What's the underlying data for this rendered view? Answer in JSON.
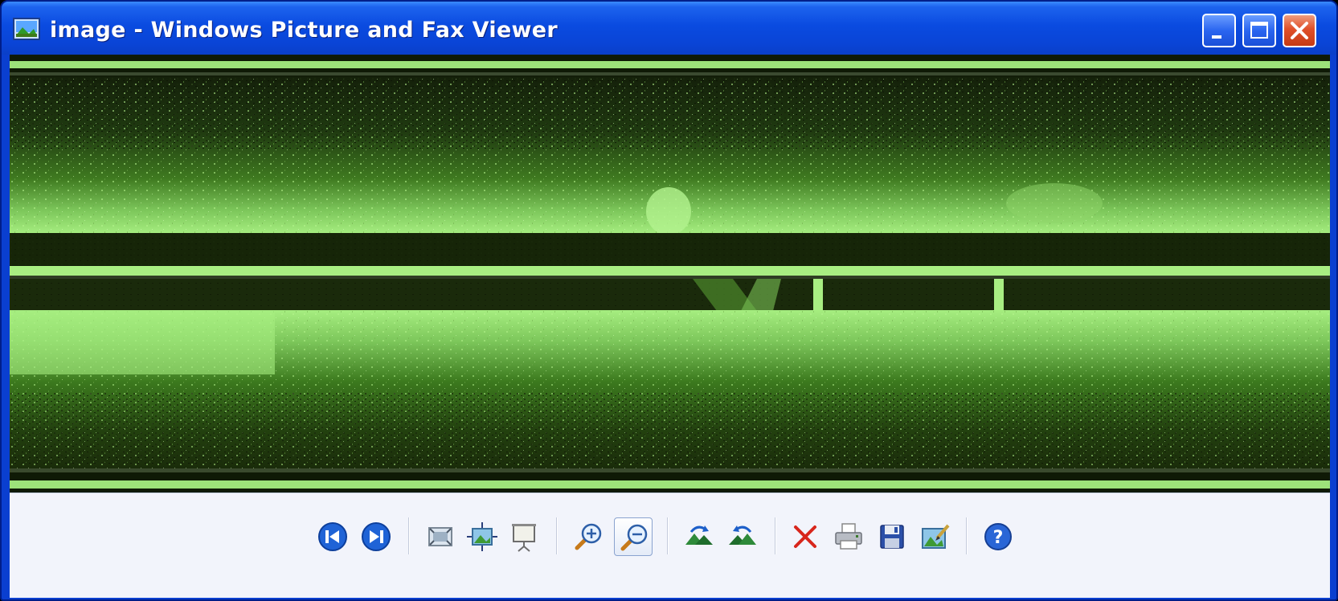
{
  "window": {
    "title": "image - Windows Picture and Fax Viewer",
    "icon": "picture-viewer-icon"
  },
  "caption_buttons": [
    "minimize-icon",
    "maximize-icon",
    "close-icon"
  ],
  "colors": {
    "titlebar": "#0a4be0",
    "close_button": "#e0502a",
    "image_bright_green": "#a6f27c",
    "image_dark": "#0f1a06",
    "toolbar_background": "#f2f4fb"
  },
  "toolbar": {
    "buttons": [
      {
        "icon": "previous-image-icon"
      },
      {
        "icon": "next-image-icon"
      },
      {
        "icon": "best-fit-icon"
      },
      {
        "icon": "actual-size-icon"
      },
      {
        "icon": "slide-show-icon"
      },
      {
        "icon": "zoom-in-icon"
      },
      {
        "icon": "zoom-out-icon",
        "state": "pressed"
      },
      {
        "icon": "rotate-clockwise-icon"
      },
      {
        "icon": "rotate-counterclockwise-icon"
      },
      {
        "icon": "delete-icon"
      },
      {
        "icon": "print-icon"
      },
      {
        "icon": "save-icon"
      },
      {
        "icon": "edit-image-icon"
      },
      {
        "icon": "help-icon"
      }
    ]
  }
}
